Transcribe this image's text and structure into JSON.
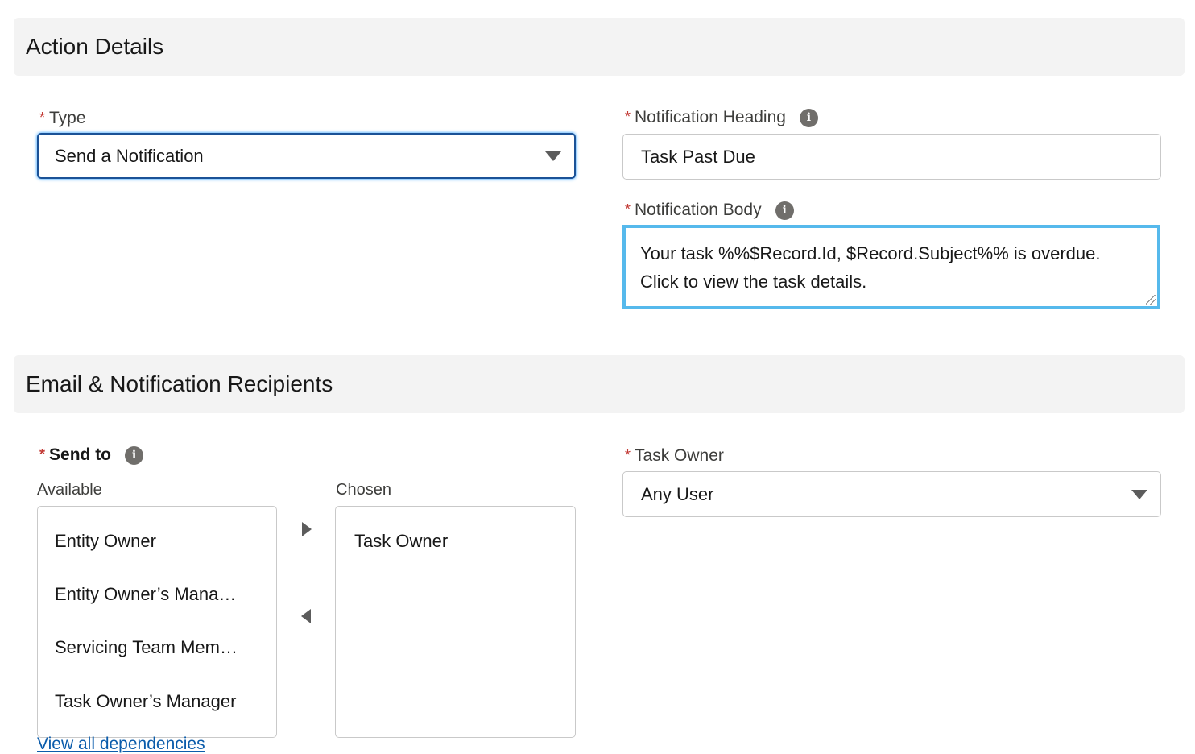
{
  "action_details": {
    "header": "Action Details",
    "type": {
      "required_mark": "*",
      "label": "Type",
      "value": "Send a Notification"
    },
    "notification_heading": {
      "required_mark": "*",
      "label": "Notification Heading",
      "value": "Task Past Due",
      "info_icon": "info-icon"
    },
    "notification_body": {
      "required_mark": "*",
      "label": "Notification Body",
      "value": "Your task %%$Record.Id, $Record.Subject%% is overdue. Click to view the task details.",
      "info_icon": "info-icon"
    }
  },
  "recipients": {
    "header": "Email & Notification Recipients",
    "send_to": {
      "required_mark": "*",
      "label": "Send to",
      "info_icon": "info-icon",
      "available_label": "Available",
      "chosen_label": "Chosen",
      "available": [
        "Entity Owner",
        "Entity Owner’s Mana…",
        "Servicing Team Mem…",
        "Task Owner’s Manager"
      ],
      "chosen": [
        "Task Owner"
      ],
      "move_right_icon": "triangle-right-icon",
      "move_left_icon": "triangle-left-icon"
    },
    "task_owner": {
      "required_mark": "*",
      "label": "Task Owner",
      "value": "Any User"
    },
    "view_dependencies_link": "View all dependencies"
  },
  "colors": {
    "required": "#c23934",
    "focus_border": "#1b5297",
    "textarea_focus": "#56b9ec",
    "header_bg": "#f3f3f3",
    "link": "#0b5cab"
  }
}
